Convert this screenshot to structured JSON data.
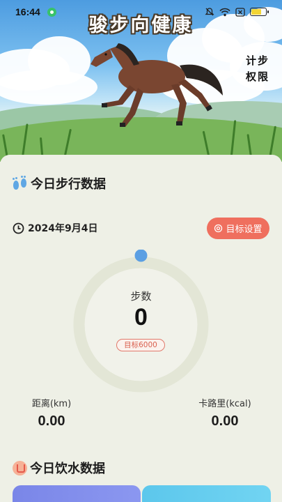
{
  "status_bar": {
    "time": "16:44"
  },
  "hero": {
    "title": "骏步向健康",
    "side_button": "计步权限"
  },
  "steps_section": {
    "title": "今日步行数据",
    "date": "2024年9月4日",
    "goal_button": "目标设置",
    "steps_label": "步数",
    "steps_value": "0",
    "goal_badge": "目标6000",
    "progress_fraction": 0,
    "distance_label": "距离(km)",
    "distance_value": "0.00",
    "calories_label": "卡路里(kcal)",
    "calories_value": "0.00"
  },
  "water_section": {
    "title": "今日饮水数据"
  },
  "colors": {
    "accent_red": "#ef6f5e",
    "ring_blue": "#5b9fe3",
    "background": "#eef0e6"
  },
  "icons": [
    "feet-icon",
    "clock-icon",
    "gear-icon",
    "cup-icon",
    "wifi-icon",
    "battery-icon",
    "mute-icon"
  ]
}
